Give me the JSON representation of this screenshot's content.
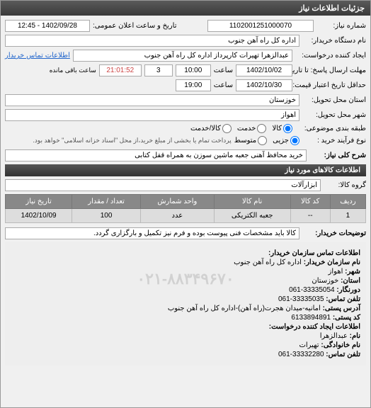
{
  "header": {
    "title": "جزئیات اطلاعات نیاز"
  },
  "form": {
    "request_number_label": "شماره نیاز:",
    "request_number": "1102001251000070",
    "announce_date_label": "تاریخ و ساعت اعلان عمومی:",
    "announce_date": "1402/09/28 - 12:45",
    "buyer_org_label": "نام دستگاه خریدار:",
    "buyer_org": "اداره کل راه آهن جنوب",
    "request_creator_label": "ایجاد کننده درخواست:",
    "request_creator": "عبدالزهرا تهیرات کارپرداز اداره کل راه آهن جنوب",
    "contact_link": "اطلاعات تماس خریدار",
    "deadline_label": "مهلت ارسال پاسخ: تا تاریخ:",
    "deadline_date": "1402/10/02",
    "time_label": "ساعت",
    "deadline_time": "10:00",
    "remaining": "3",
    "remaining_timer": "21:01:52",
    "remaining_suffix": "ساعت باقی مانده",
    "validity_label": "حداقل تاریخ اعتبار قیمت: تا تاریخ:",
    "validity_date": "1402/10/30",
    "validity_time": "19:00",
    "delivery_province_label": "استان محل تحویل:",
    "delivery_province": "خوزستان",
    "delivery_city_label": "شهر محل تحویل:",
    "delivery_city": "اهواز",
    "subject_type_label": "طبقه بندی موضوعی:",
    "radio_goods": "کالا",
    "radio_service": "خدمت",
    "radio_goods_service": "کالا/خدمت",
    "purchase_type_label": "نوع فرآیند خرید :",
    "radio_small": "جزیی",
    "radio_medium": "متوسط",
    "purchase_note": "پرداخت تمام یا بخشی از مبلغ خرید،از محل \"اسناد خزانه اسلامی\" خواهد بود."
  },
  "need": {
    "title_label": "شرح کلی نیاز:",
    "title": "خرید محافظ آهنی جعبه ماشین سوزن به همراه قفل کتابی"
  },
  "goods": {
    "section_title": "اطلاعات کالاهای مورد نیاز",
    "group_label": "گروه کالا:",
    "group": "ابزارآلات",
    "columns": {
      "row": "ردیف",
      "code": "کد کالا",
      "name": "نام کالا",
      "unit": "واحد شمارش",
      "qty": "تعداد / مقدار",
      "date": "تاریخ نیاز"
    },
    "rows": [
      {
        "row": "1",
        "code": "--",
        "name": "جعبه الکتریکی",
        "unit": "عدد",
        "qty": "100",
        "date": "1402/10/09"
      }
    ]
  },
  "buyer_notes": {
    "label": "توضیحات خریدار:",
    "text": "کالا باید مشخصات فنی پیوست بوده و فرم نیز تکمیل و بارگزاری گردد."
  },
  "contact": {
    "section_title": "اطلاعات تماس سازمان خریدار:",
    "org_name_label": "نام سازمان خریدار:",
    "org_name": "اداره کل راه آهن جنوب",
    "city_label": "شهر:",
    "city": "اهواز",
    "province_label": "استان:",
    "province": "خوزستان",
    "fax_label": "دورنگار:",
    "fax": "33335054-061",
    "phone_label": "تلفن تماس:",
    "phone": "33335035-061",
    "address_label": "آدرس پستی:",
    "address": "امانیه-میدان هجرت(راه آهن)-اداره کل راه آهن جنوب",
    "postal_code_label": "کد پستی:",
    "postal_code": "6133894891",
    "creator_section": "اطلاعات ایجاد کننده درخواست:",
    "creator_name_label": "نام:",
    "creator_name": "عبدالزهرا",
    "creator_family_label": "نام خانوادگی:",
    "creator_family": "تهیرات",
    "creator_phone_label": "تلفن تماس:",
    "creator_phone": "33332280-061",
    "watermark": "۰۲۱-۸۸۳۴۹۶۷۰"
  }
}
